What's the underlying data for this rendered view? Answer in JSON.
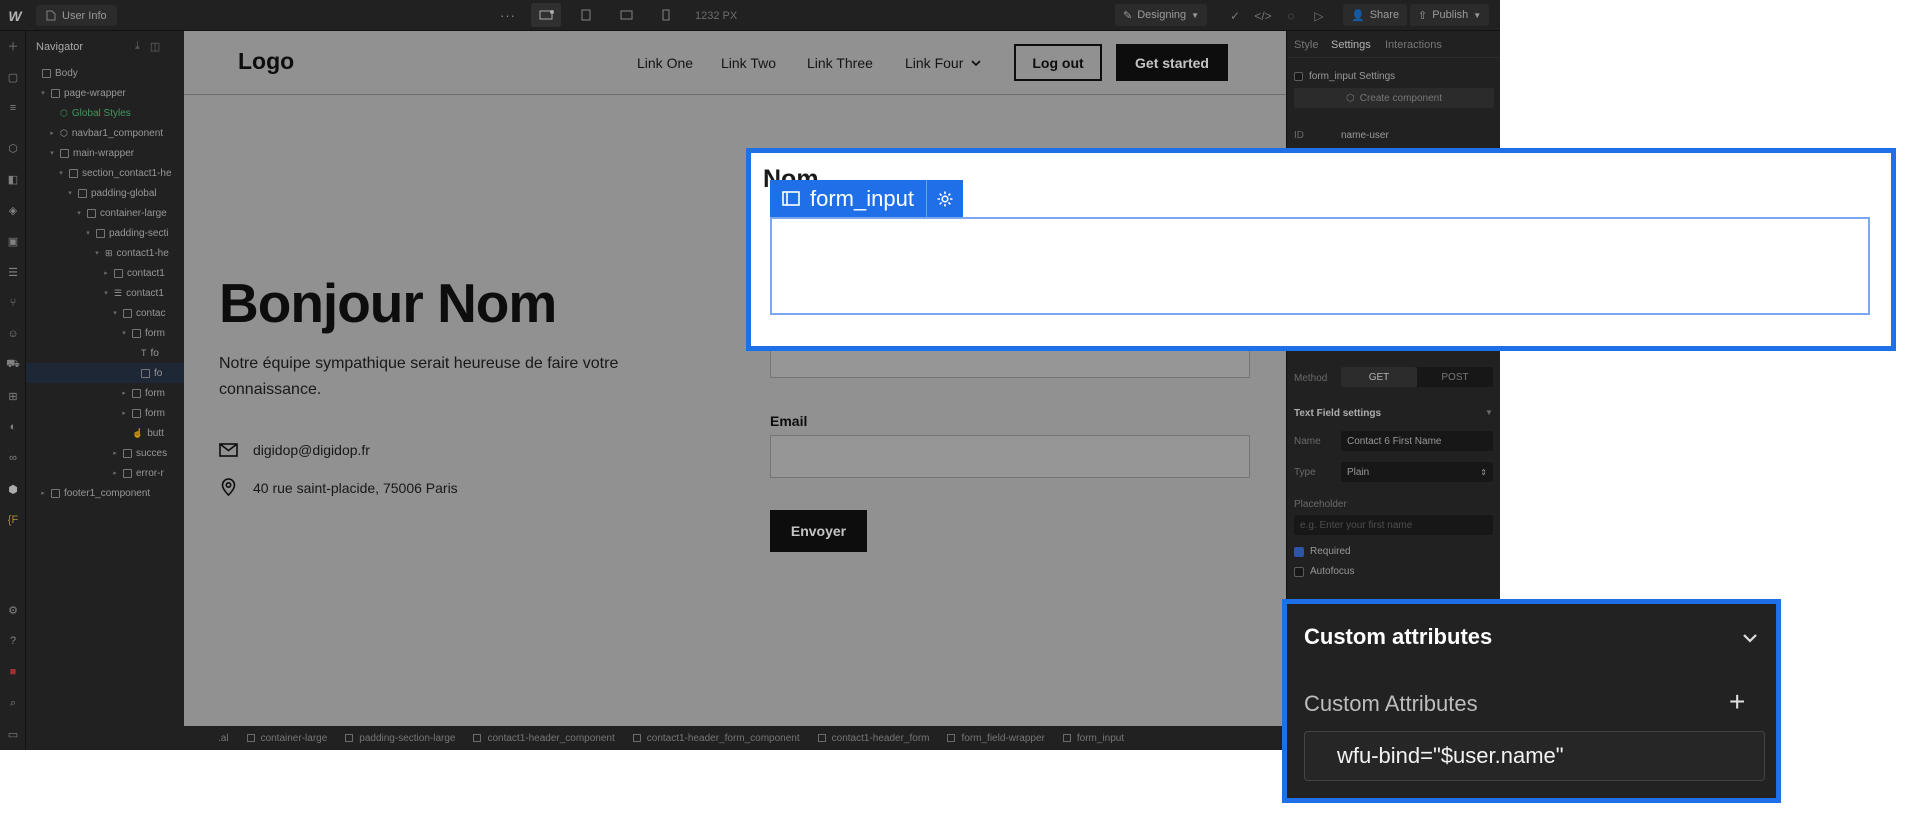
{
  "topbar": {
    "logo": "W",
    "page_name": "User Info",
    "canvas_width": "1232 PX",
    "mode": "Designing",
    "share": "Share",
    "publish": "Publish"
  },
  "navigator": {
    "title": "Navigator",
    "items": [
      {
        "label": "Body"
      },
      {
        "label": "page-wrapper"
      },
      {
        "label": "Global Styles"
      },
      {
        "label": "navbar1_component"
      },
      {
        "label": "main-wrapper"
      },
      {
        "label": "section_contact1-he"
      },
      {
        "label": "padding-global"
      },
      {
        "label": "container-large"
      },
      {
        "label": "padding-secti"
      },
      {
        "label": "contact1-he"
      },
      {
        "label": "contact1"
      },
      {
        "label": "contact1"
      },
      {
        "label": "contac"
      },
      {
        "label": "form"
      },
      {
        "label": "fo"
      },
      {
        "label": "fo"
      },
      {
        "label": "form"
      },
      {
        "label": "form"
      },
      {
        "label": "butt"
      },
      {
        "label": "succes"
      },
      {
        "label": "error-r"
      },
      {
        "label": "footer1_component"
      }
    ]
  },
  "site": {
    "logo": "Logo",
    "links": [
      "Link One",
      "Link Two",
      "Link Three",
      "Link Four"
    ],
    "logout": "Log out",
    "get_started": "Get started",
    "hero_title": "Bonjour Nom",
    "hero_desc": "Notre équipe sympathique serait heureuse de faire votre connaissance.",
    "email": "digidop@digidop.fr",
    "address": "40 rue saint-placide, 75006 Paris",
    "email_label": "Email",
    "submit": "Envoyer"
  },
  "breadcrumbs": [
    ".al",
    "container-large",
    "padding-section-large",
    "contact1-header_component",
    "contact1-header_form_component",
    "contact1-header_form",
    "form_field-wrapper",
    "form_input"
  ],
  "panel": {
    "tabs": [
      "Style",
      "Settings",
      "Interactions"
    ],
    "settings_title": "form_input Settings",
    "create_component": "Create component",
    "id_label": "ID",
    "id_value": "name-user",
    "method_label": "Method",
    "method_get": "GET",
    "method_post": "POST",
    "text_field_title": "Text Field settings",
    "name_label": "Name",
    "name_value": "Contact 6 First Name",
    "type_label": "Type",
    "type_value": "Plain",
    "placeholder_label": "Placeholder",
    "placeholder_hint": "e.g. Enter your first name",
    "required": "Required",
    "autofocus": "Autofocus"
  },
  "callout_field": {
    "label": "Nom",
    "badge": "form_input"
  },
  "callout_attrs": {
    "title": "Custom attributes",
    "subtitle": "Custom Attributes",
    "attribute": "wfu-bind=\"$user.name\""
  },
  "colors": {
    "accent": "#1f6fe8"
  }
}
